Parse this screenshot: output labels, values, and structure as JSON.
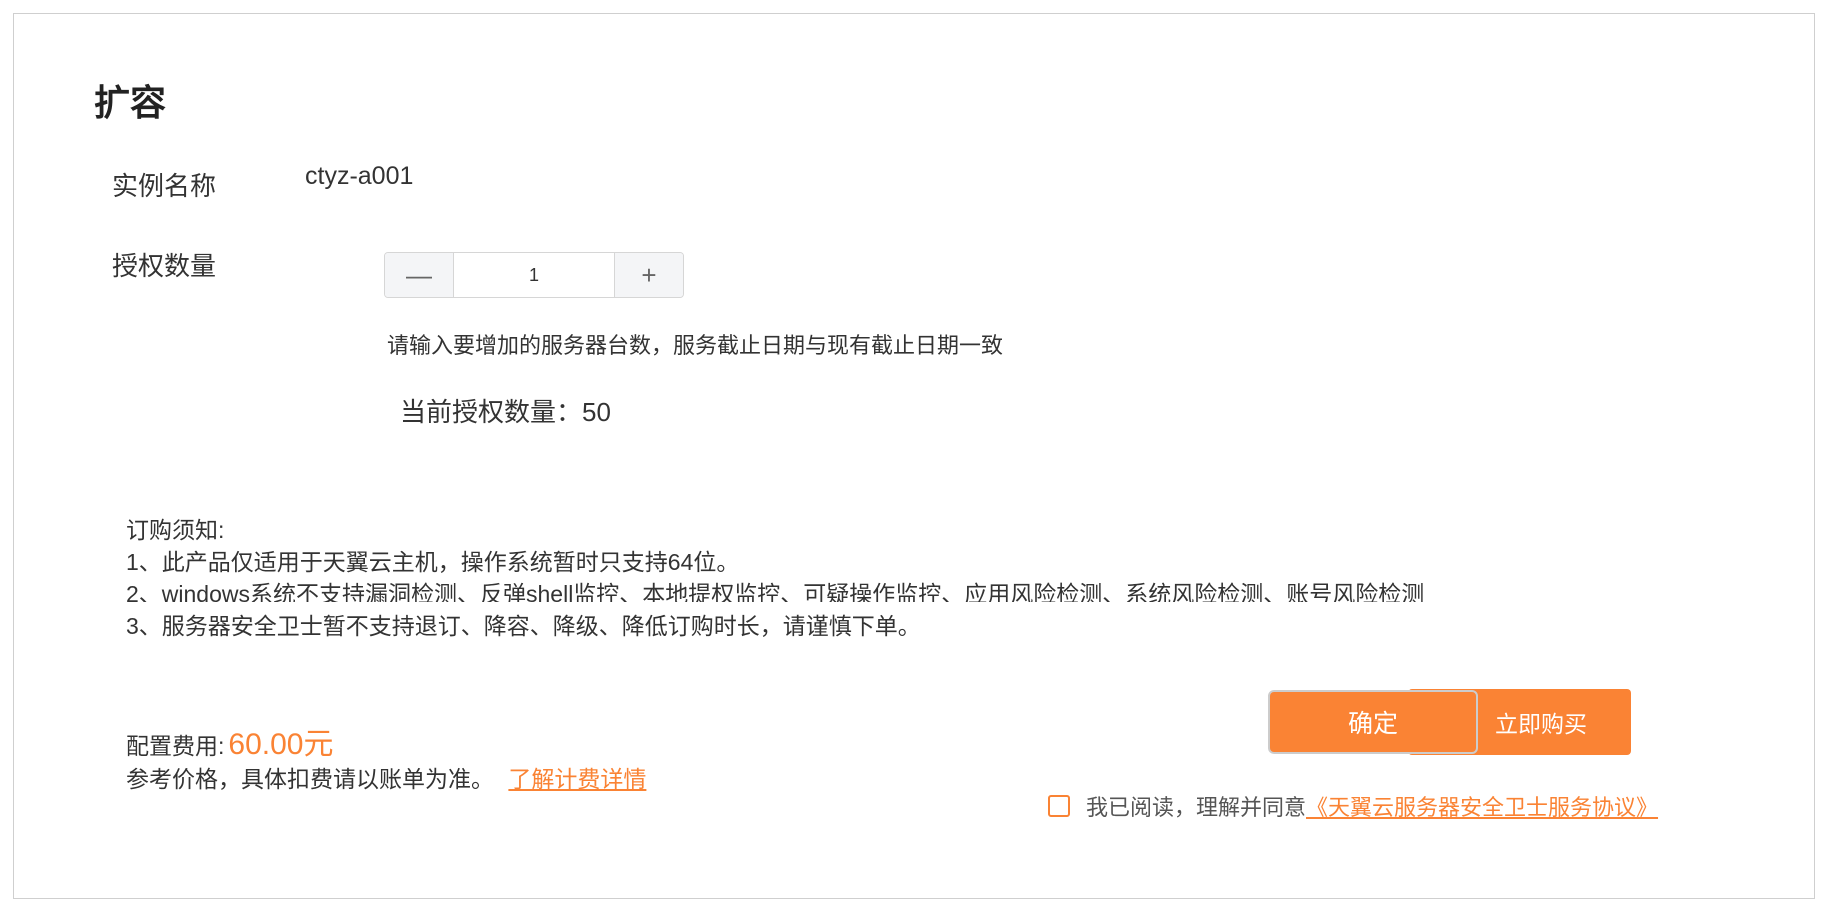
{
  "page": {
    "title": "扩容"
  },
  "instance": {
    "label": "实例名称",
    "value": "ctyz-a001"
  },
  "license": {
    "label": "授权数量",
    "minus_symbol": "—",
    "plus_symbol": "+",
    "quantity": "1",
    "hint": "请输入要增加的服务器台数，服务截止日期与现有截止日期一致",
    "current_text": "当前授权数量：50"
  },
  "notice": {
    "heading": "订购须知:",
    "items": [
      "1、此产品仅适用于天翼云主机，操作系统暂时只支持64位。",
      "2、windows系统不支持漏洞检测、反弹shell监控、本地提权监控、可疑操作监控、应用风险检测、系统风险检测、账号风险检测",
      "3、服务器安全卫士暂不支持退订、降容、降级、降低订购时长，请谨慎下单。"
    ]
  },
  "fee": {
    "label": "配置费用:",
    "value": "60.00元",
    "reference_text": "参考价格，具体扣费请以账单为准。",
    "details_link": "了解计费详情"
  },
  "actions": {
    "buy_label": "立即购买",
    "confirm_label": "确定"
  },
  "agreement": {
    "text": "我已阅读，理解并同意",
    "link": "《天翼云服务器安全卫士服务协议》",
    "checked": false
  },
  "colors": {
    "accent": "#fa8334",
    "border": "#cfcfcf",
    "text": "#333333"
  }
}
